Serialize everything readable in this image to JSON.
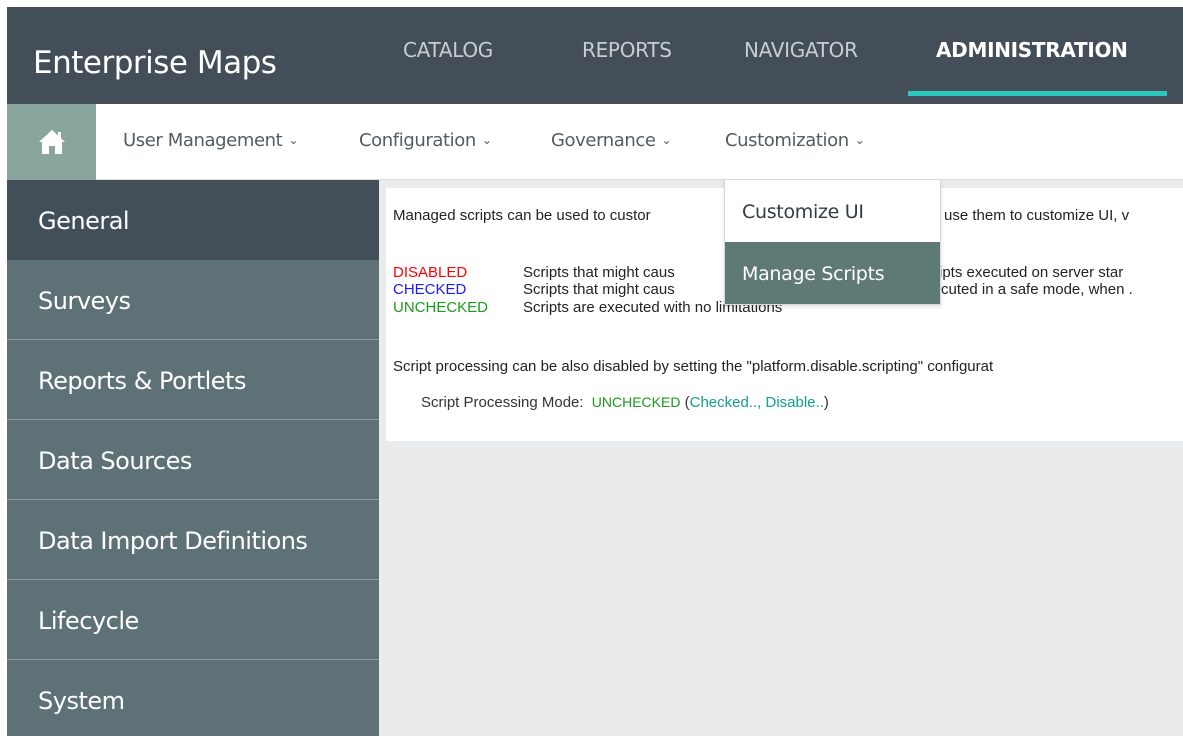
{
  "header": {
    "app_title": "Enterprise Maps",
    "nav": [
      "CATALOG",
      "REPORTS",
      "NAVIGATOR",
      "ADMINISTRATION"
    ],
    "active_nav": "ADMINISTRATION"
  },
  "subnav": {
    "home_icon": "home-icon",
    "items": [
      "User Management",
      "Configuration",
      "Governance",
      "Customization"
    ]
  },
  "sidebar": {
    "items": [
      "General",
      "Surveys",
      "Reports & Portlets",
      "Data Sources",
      "Data Import Definitions",
      "Lifecycle",
      "System"
    ],
    "active": "General"
  },
  "content": {
    "intro_left": "Managed scripts can be used to custor",
    "intro_right": "use them to customize UI, v",
    "modes": [
      {
        "name": "DISABLED",
        "color": "#ff0000",
        "desc_left": "Scripts that might caus",
        "desc_right": "ipts executed on server star"
      },
      {
        "name": "CHECKED",
        "color": "#1a1aff",
        "desc_left": "Scripts that might caus",
        "desc_right": "cuted in a safe mode, when ."
      },
      {
        "name": "UNCHECKED",
        "color": "#1a9a1a",
        "desc_left": "Scripts are executed with no limitations",
        "desc_right": ""
      }
    ],
    "disable_note": "Script processing can be also disabled by setting the \"platform.disable.scripting\" configurat",
    "mode_label": "Script Processing Mode:",
    "mode_value": "UNCHECKED",
    "mode_value_color": "#1a9a1a",
    "link_open": "(",
    "link_checked": "Checked..",
    "link_sep": ", ",
    "link_disable": "Disable..",
    "link_close": ")",
    "link_color": "#14a088"
  },
  "dropdown": {
    "items": [
      "Customize UI",
      "Manage Scripts"
    ],
    "hovered": "Manage Scripts"
  },
  "colors": {
    "topbar": "#434e59",
    "accent": "#2bc7be",
    "sidebar": "#5e7177",
    "sidebar_active": "#424e58",
    "home_button": "#8aa59e",
    "dropdown_hover": "#5f7975"
  }
}
